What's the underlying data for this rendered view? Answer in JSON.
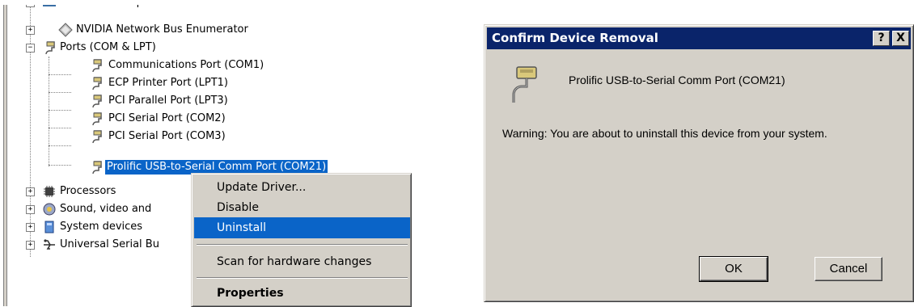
{
  "tree": {
    "rows": [
      {
        "label": "Network adapters",
        "icon": "network-adapter-icon",
        "expander": "+"
      },
      {
        "label": "NVIDIA Network Bus Enumerator",
        "icon": "bus-enumerator-icon",
        "expander": "+"
      },
      {
        "label": "Ports (COM & LPT)",
        "icon": "port-icon",
        "expander": "−"
      },
      {
        "label": "Communications Port (COM1)",
        "icon": "port-icon"
      },
      {
        "label": "ECP Printer Port (LPT1)",
        "icon": "port-icon"
      },
      {
        "label": "PCI Parallel Port (LPT3)",
        "icon": "port-icon"
      },
      {
        "label": "PCI Serial Port (COM2)",
        "icon": "port-icon"
      },
      {
        "label": "PCI Serial Port (COM3)",
        "icon": "port-icon"
      },
      {
        "label": "Prolific USB-to-Serial Comm Port (COM21)",
        "icon": "port-icon",
        "selected": true
      },
      {
        "label": "Processors",
        "icon": "processor-icon",
        "expander": "+"
      },
      {
        "label": "Sound, video and",
        "icon": "sound-icon",
        "expander": "+"
      },
      {
        "label": "System devices",
        "icon": "system-devices-icon",
        "expander": "+"
      },
      {
        "label": "Universal Serial Bu",
        "icon": "usb-icon",
        "expander": "+"
      }
    ]
  },
  "context_menu": {
    "items": [
      {
        "label": "Update Driver..."
      },
      {
        "label": "Disable"
      },
      {
        "label": "Uninstall",
        "highlighted": true
      },
      {
        "label": "Scan for hardware changes"
      },
      {
        "label": "Properties",
        "bold": true
      }
    ]
  },
  "dialog": {
    "title": "Confirm Device Removal",
    "help_button": "?",
    "close_button": "X",
    "device_name": "Prolific USB-to-Serial Comm Port (COM21)",
    "warning": "Warning: You are about to uninstall this device from your system.",
    "ok_label": "OK",
    "cancel_label": "Cancel"
  },
  "colors": {
    "selection": "#0a64c8",
    "titlebar": "#0a246a",
    "face": "#d4d0c8"
  }
}
